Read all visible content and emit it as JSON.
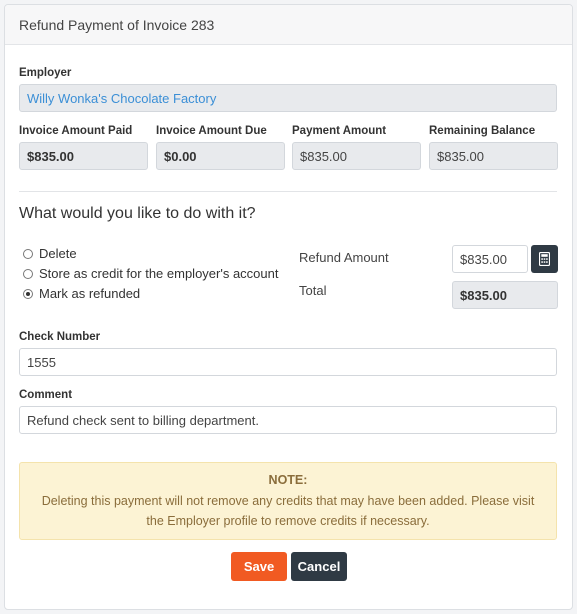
{
  "modal": {
    "title": "Refund Payment of Invoice 283"
  },
  "employer": {
    "label": "Employer",
    "value": "Willy Wonka's Chocolate Factory"
  },
  "amounts": {
    "invoice_paid": {
      "label": "Invoice Amount Paid",
      "value": "$835.00"
    },
    "invoice_due": {
      "label": "Invoice Amount Due",
      "value": "$0.00"
    },
    "payment_amount": {
      "label": "Payment Amount",
      "value": "$835.00"
    },
    "remaining_balance": {
      "label": "Remaining Balance",
      "value": "$835.00"
    }
  },
  "action": {
    "question": "What would you like to do with it?",
    "options": [
      {
        "label": "Delete",
        "selected": false
      },
      {
        "label": "Store as credit for the employer's account",
        "selected": false
      },
      {
        "label": "Mark as refunded",
        "selected": true
      }
    ],
    "refund_amount_label": "Refund Amount",
    "refund_amount_value": "$835.00",
    "calculator_icon": "calculator-icon",
    "total_label": "Total",
    "total_value": "$835.00"
  },
  "check_number": {
    "label": "Check Number",
    "value": "1555"
  },
  "comment": {
    "label": "Comment",
    "value": "Refund check sent to billing department."
  },
  "note": {
    "title": "NOTE:",
    "text": "Deleting this payment will not remove any credits that may have been added. Please visit the Employer profile to remove credits if necessary."
  },
  "buttons": {
    "save": "Save",
    "cancel": "Cancel"
  },
  "colors": {
    "save": "#f15a22",
    "dark": "#2f3a44",
    "link": "#3b8fd6",
    "note_bg": "#fcf3d4",
    "note_text": "#8a6d3b"
  }
}
